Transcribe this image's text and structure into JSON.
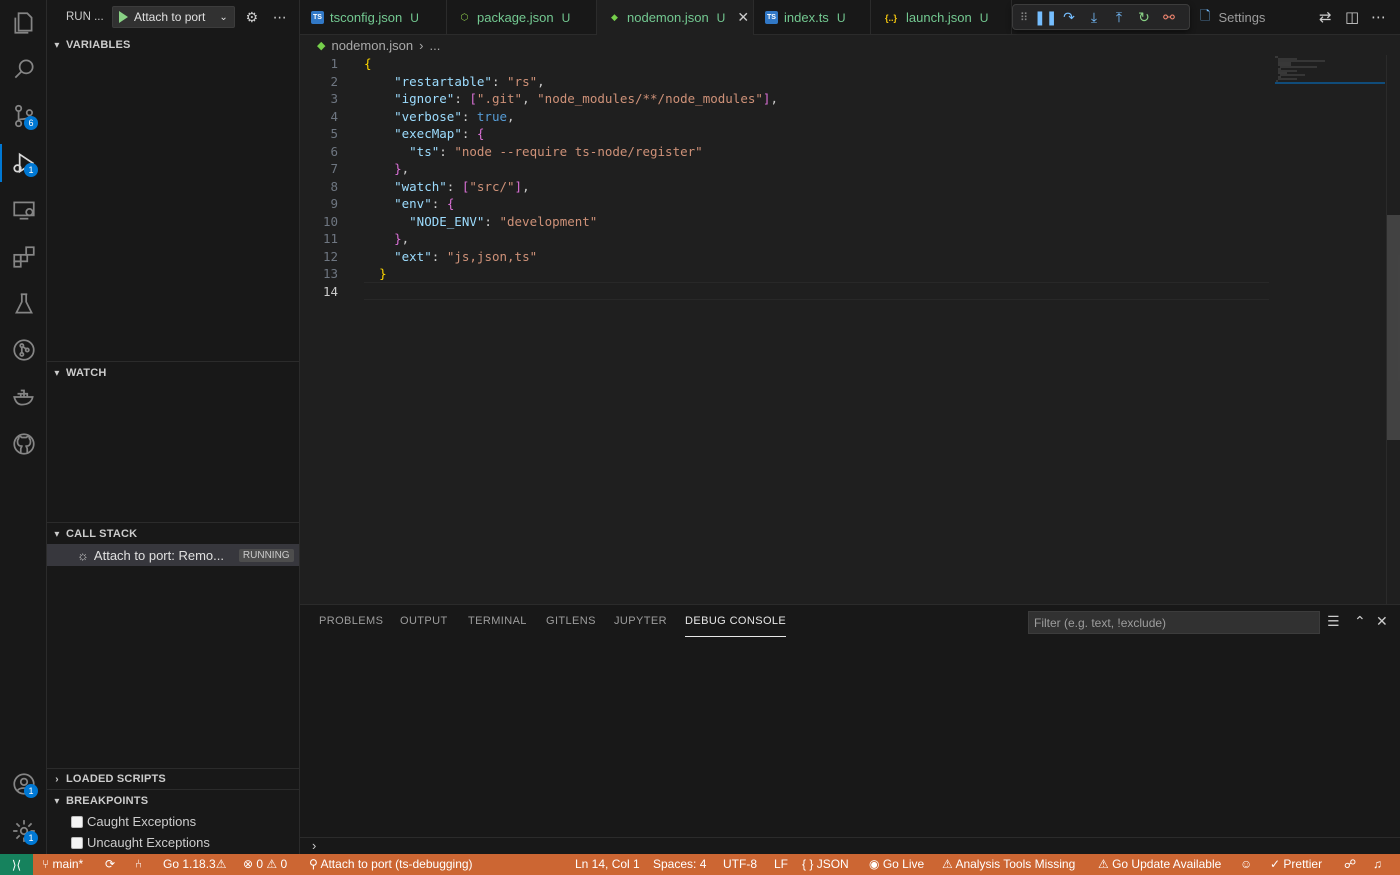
{
  "sidebar": {
    "title": "RUN ...",
    "config_label": "Attach to port",
    "sections": {
      "variables": "VARIABLES",
      "watch": "WATCH",
      "call_stack": "CALL STACK",
      "loaded_scripts": "LOADED SCRIPTS",
      "breakpoints": "BREAKPOINTS"
    },
    "call_stack_item": {
      "label": "Attach to port: Remo...",
      "status": "RUNNING"
    },
    "breakpoints": [
      "Caught Exceptions",
      "Uncaught Exceptions"
    ]
  },
  "activity_bar": {
    "source_control_badge": "6",
    "debug_badge": "1",
    "accounts_badge": "1",
    "settings_badge": "1"
  },
  "tabs": [
    {
      "name": "tsconfig.json",
      "status": "U",
      "icon": "TS"
    },
    {
      "name": "package.json",
      "status": "U",
      "icon": "⬡"
    },
    {
      "name": "nodemon.json",
      "status": "U",
      "icon": "◆"
    },
    {
      "name": "index.ts",
      "status": "U",
      "icon": "TS"
    },
    {
      "name": "launch.json",
      "status": "U",
      "icon": "{..}"
    }
  ],
  "settings_tab": "Settings",
  "breadcrumb": {
    "file": "nodemon.json",
    "rest": "..."
  },
  "editor": {
    "current_line": 14
  },
  "panel": {
    "tabs": [
      "PROBLEMS",
      "OUTPUT",
      "TERMINAL",
      "GITLENS",
      "JUPYTER",
      "DEBUG CONSOLE"
    ],
    "active_tab": "DEBUG CONSOLE",
    "filter_placeholder": "Filter (e.g. text, !exclude)"
  },
  "statusbar": {
    "branch": "main*",
    "go_version": "Go 1.18.3",
    "errors": "0",
    "warnings": "0",
    "debug_session": "Attach to port (ts-debugging)",
    "cursor": "Ln 14, Col 1",
    "spaces": "Spaces: 4",
    "encoding": "UTF-8",
    "eol": "LF",
    "language": "JSON",
    "go_live": "Go Live",
    "analysis": "Analysis Tools Missing",
    "go_update": "Go Update Available",
    "prettier": "Prettier"
  },
  "colors": {
    "statusbar_bg": "#cc6633",
    "remote_bg": "#16825d",
    "accent": "#0078d4"
  }
}
